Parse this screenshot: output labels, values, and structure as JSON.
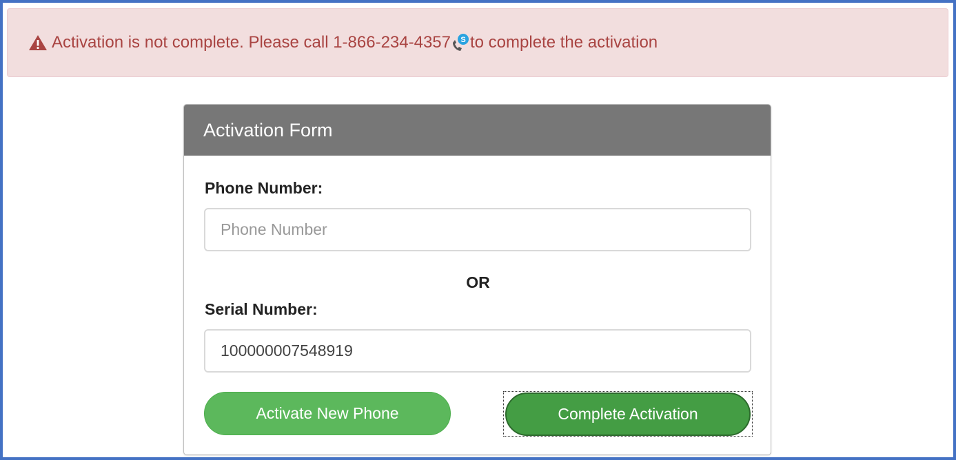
{
  "alert": {
    "icon": "warning-triangle-icon",
    "text_before": "Activation is not complete. Please call 1-866-234-4357",
    "call_icon": "skype-phone-icon",
    "text_after": " to complete the activation",
    "color": "#a94442",
    "background": "#f2dede"
  },
  "form": {
    "title": "Activation Form",
    "header_color": "#777777",
    "phone_label": "Phone Number:",
    "phone_value": "",
    "phone_placeholder": "Phone Number",
    "or_text": "OR",
    "serial_label": "Serial Number:",
    "serial_value": "100000007548919",
    "activate_button": "Activate New Phone",
    "complete_button": "Complete Activation",
    "activate_color": "#5cb85c",
    "complete_color": "#449d44"
  }
}
